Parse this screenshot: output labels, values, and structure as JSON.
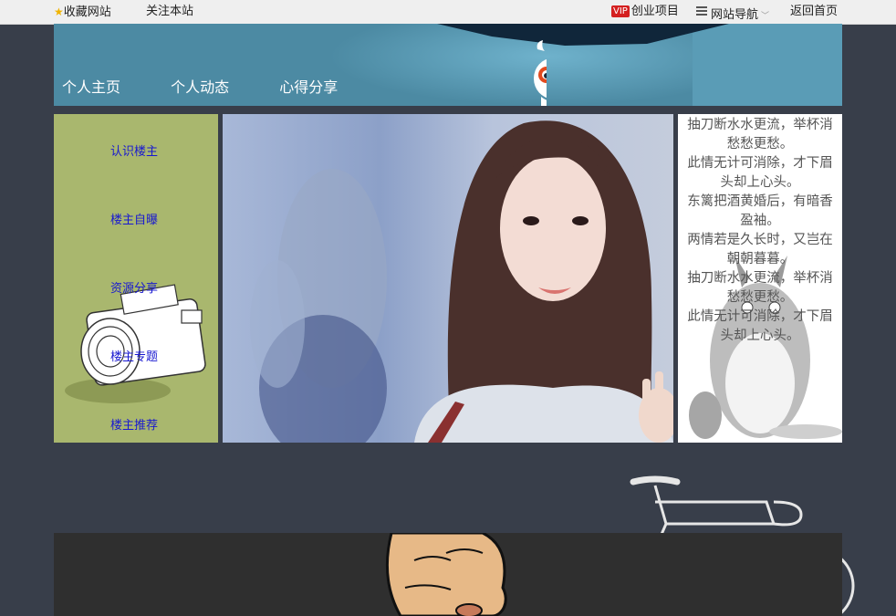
{
  "topbar": {
    "bookmark": "收藏网站",
    "follow": "关注本站",
    "vip_badge": "VIP",
    "startup": "创业项目",
    "site_nav": "网站导航",
    "home": "返回首页"
  },
  "banner": {
    "nav": [
      "个人主页",
      "个人动态",
      "心得分享"
    ]
  },
  "sidebar": {
    "links": [
      "认识楼主",
      "楼主自曝",
      "资源分享",
      "楼主专题",
      "楼主推荐"
    ]
  },
  "poem": {
    "lines": [
      "抽刀断水水更流，举杯消",
      "愁愁更愁。",
      "此情无计可消除，才下眉",
      "头却上心头。",
      "东篱把酒黄婚后，有暗香",
      "盈袖。",
      "两情若是久长时，又岂在",
      "朝朝暮暮。",
      "抽刀断水水更流，举杯消",
      "愁愁更愁。",
      "此情无计可消除，才下眉",
      "头却上心头。"
    ]
  },
  "colors": {
    "page_bg": "#383e4a",
    "banner_bg": "#4c8aa3",
    "sidebar_bg": "#a9b76e",
    "link": "#1818d0"
  }
}
